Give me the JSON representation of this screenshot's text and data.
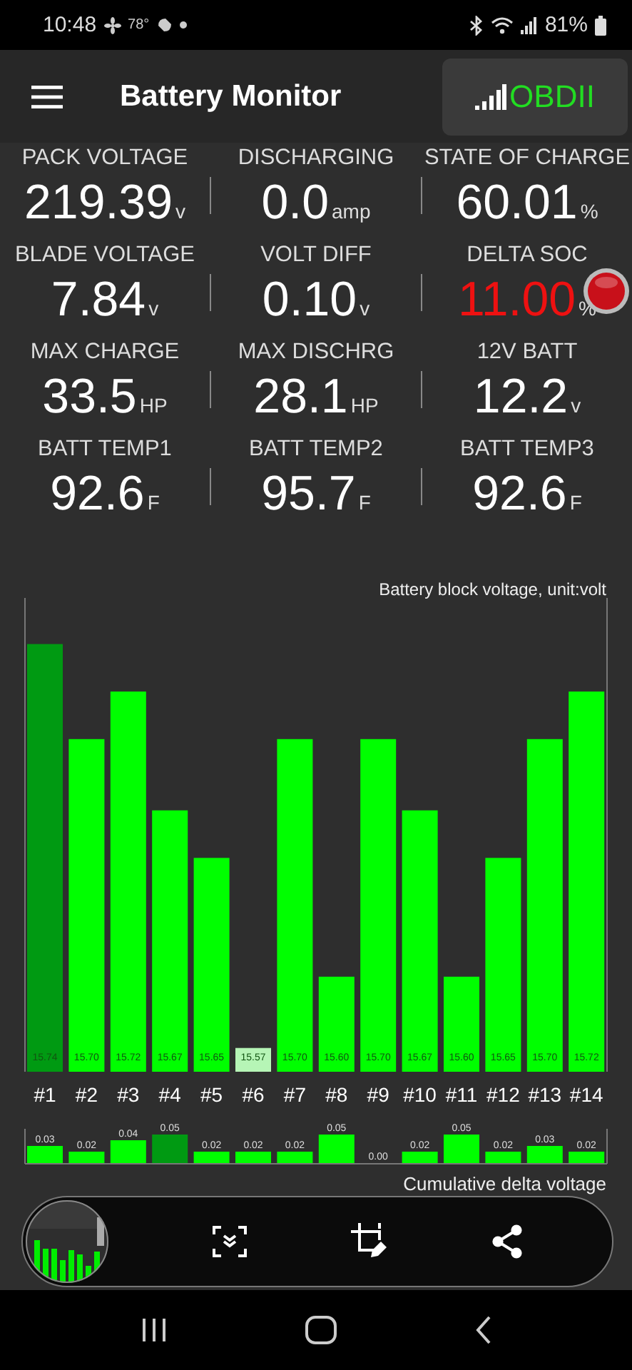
{
  "status_bar": {
    "time": "10:48",
    "temperature": "78°",
    "battery": "81%"
  },
  "app_bar": {
    "title": "Battery Monitor",
    "connection": "OBDII"
  },
  "metrics": [
    {
      "label": "PACK VOLTAGE",
      "value": "219.39",
      "unit": "v",
      "alert": false
    },
    {
      "label": "DISCHARGING",
      "value": "0.0",
      "unit": "amp",
      "alert": false
    },
    {
      "label": "STATE OF CHARGE",
      "value": "60.01",
      "unit": "%",
      "alert": false
    },
    {
      "label": "BLADE VOLTAGE",
      "value": "7.84",
      "unit": "v",
      "alert": false
    },
    {
      "label": "VOLT DIFF",
      "value": "0.10",
      "unit": "v",
      "alert": false
    },
    {
      "label": "DELTA SOC",
      "value": "11.00",
      "unit": "%",
      "alert": true
    },
    {
      "label": "MAX CHARGE",
      "value": "33.5",
      "unit": "HP",
      "alert": false
    },
    {
      "label": "MAX DISCHRG",
      "value": "28.1",
      "unit": "HP",
      "alert": false
    },
    {
      "label": "12V BATT",
      "value": "12.2",
      "unit": "v",
      "alert": false
    },
    {
      "label": "BATT TEMP1",
      "value": "92.6",
      "unit": "F",
      "alert": false
    },
    {
      "label": "BATT TEMP2",
      "value": "95.7",
      "unit": "F",
      "alert": false
    },
    {
      "label": "BATT TEMP3",
      "value": "92.6",
      "unit": "F",
      "alert": false
    }
  ],
  "warning_light": {
    "on": true
  },
  "block_chart": {
    "chart_data": {
      "type": "bar",
      "title": "Battery block voltage, unit:volt",
      "categories": [
        "#1",
        "#2",
        "#3",
        "#4",
        "#5",
        "#6",
        "#7",
        "#8",
        "#9",
        "#10",
        "#11",
        "#12",
        "#13",
        "#14"
      ],
      "ylim": [
        15.56,
        15.76
      ],
      "stacked": true,
      "series": [
        {
          "color": "#00ff00",
          "values": [
            null,
            15.7,
            15.72,
            15.67,
            15.65,
            null,
            15.7,
            15.6,
            15.7,
            15.67,
            15.6,
            15.65,
            15.7,
            15.72
          ],
          "value_labels": [
            null,
            "15.70",
            "15.72",
            "15.67",
            "15.65",
            null,
            "15.70",
            "15.60",
            "15.70",
            "15.67",
            "15.60",
            "15.65",
            "15.70",
            "15.72"
          ]
        },
        {
          "color": "#009a12",
          "values": [
            15.74,
            null,
            null,
            null,
            null,
            null,
            null,
            null,
            null,
            null,
            null,
            null,
            null,
            null
          ],
          "value_labels": [
            "15.74",
            null,
            null,
            null,
            null,
            null,
            null,
            null,
            null,
            null,
            null,
            null,
            null,
            null
          ]
        },
        {
          "color": "#b6f5b6",
          "values": [
            null,
            null,
            null,
            null,
            null,
            15.57,
            null,
            null,
            null,
            null,
            null,
            null,
            null,
            null
          ],
          "value_labels": [
            null,
            null,
            null,
            null,
            null,
            "15.57",
            null,
            null,
            null,
            null,
            null,
            null,
            null,
            null
          ]
        }
      ]
    }
  },
  "delta_chart": {
    "chart_data": {
      "type": "bar",
      "title": "Cumulative delta voltage",
      "ylim": [
        0,
        0.05
      ],
      "stacked": true,
      "series": [
        {
          "color": "#00ff00",
          "values": [
            0.03,
            0.02,
            0.04,
            null,
            0.02,
            0.02,
            0.02,
            0.05,
            0.0,
            0.02,
            0.05,
            0.02,
            0.03,
            0.02
          ],
          "value_labels": [
            "0.03",
            "0.02",
            "0.04",
            null,
            "0.02",
            "0.02",
            "0.02",
            "0.05",
            "0.00",
            "0.02",
            "0.05",
            "0.02",
            "0.03",
            "0.02"
          ]
        },
        {
          "color": "#009a12",
          "values": [
            null,
            null,
            null,
            0.05,
            null,
            null,
            null,
            null,
            null,
            null,
            null,
            null,
            null,
            null
          ],
          "value_labels": [
            null,
            null,
            null,
            "0.05",
            null,
            null,
            null,
            null,
            null,
            null,
            null,
            null,
            null,
            null
          ]
        }
      ]
    }
  }
}
